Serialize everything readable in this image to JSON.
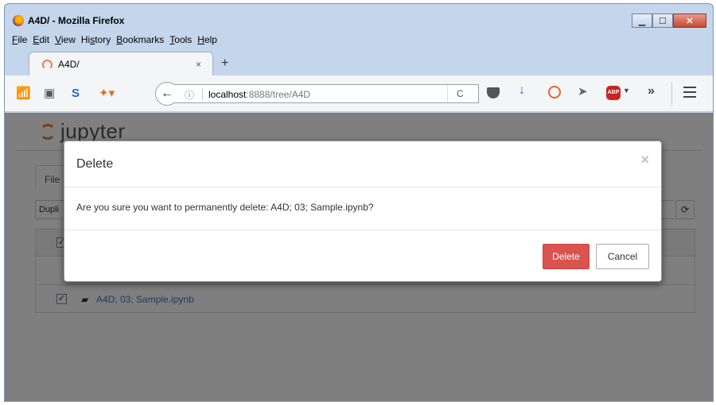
{
  "window": {
    "title": "A4D/ - Mozilla Firefox",
    "buttons": [
      "minimize",
      "maximize",
      "close"
    ]
  },
  "menu": [
    {
      "u": "F",
      "rest": "ile"
    },
    {
      "u": "E",
      "rest": "dit"
    },
    {
      "u": "V",
      "rest": "iew"
    },
    {
      "pre": "Hi",
      "u": "s",
      "rest": "tory"
    },
    {
      "u": "B",
      "rest": "ookmarks"
    },
    {
      "u": "T",
      "rest": "ools"
    },
    {
      "u": "H",
      "rest": "elp"
    }
  ],
  "tab": {
    "title": "A4D/",
    "close": "×"
  },
  "new_tab": "+",
  "urlbar": {
    "info": "ⓘ",
    "host": "localhost",
    "path": ":8888/tree/A4D",
    "reload": "C"
  },
  "toolbar": {
    "overflow": "»",
    "abp": "ABP"
  },
  "page": {
    "logo_text": "jupyter",
    "files_tab": "File",
    "duplicate_btn": "Dupli",
    "rows": [
      {
        "name": "A4D; 03; Sample.ipynb",
        "checked": true
      }
    ]
  },
  "modal": {
    "title": "Delete",
    "close": "×",
    "body": "Are you sure you want to permanently delete: A4D; 03; Sample.ipynb?",
    "delete_label": "Delete",
    "cancel_label": "Cancel"
  },
  "colors": {
    "danger": "#d9534f",
    "link": "#337ab7",
    "jupyter_orange": "#f37726"
  }
}
